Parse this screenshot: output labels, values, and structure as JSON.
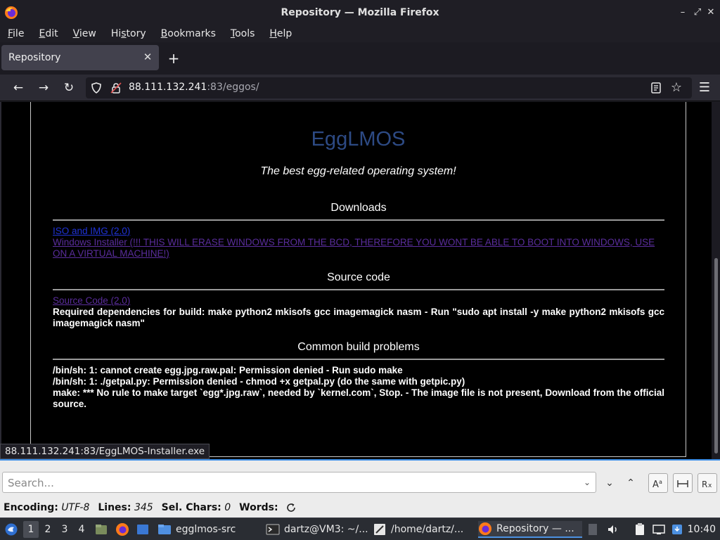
{
  "window": {
    "title": "Repository — Mozilla Firefox"
  },
  "menubar": {
    "items": [
      {
        "pre": "",
        "u": "F",
        "post": "ile"
      },
      {
        "pre": "",
        "u": "E",
        "post": "dit"
      },
      {
        "pre": "",
        "u": "V",
        "post": "iew"
      },
      {
        "pre": "Hi",
        "u": "s",
        "post": "tory"
      },
      {
        "pre": "",
        "u": "B",
        "post": "ookmarks"
      },
      {
        "pre": "",
        "u": "T",
        "post": "ools"
      },
      {
        "pre": "",
        "u": "H",
        "post": "elp"
      }
    ]
  },
  "tabs": {
    "active_label": "Repository",
    "new_tab_symbol": "+"
  },
  "navbar": {
    "url_host": "88.111.132.241",
    "url_rest": ":83/eggos/"
  },
  "page": {
    "logo": "EggLMOS",
    "tagline": "The best egg-related operating system!",
    "downloads_heading": "Downloads",
    "iso_link": "ISO and IMG (2.0)",
    "windows_installer_link": "Windows Installer (!!! THIS WILL ERASE WINDOWS FROM THE BCD, THEREFORE YOU WONT BE ABLE TO BOOT INTO WINDOWS, USE ON A VIRTUAL MACHINE!)",
    "source_heading": "Source code",
    "source_link": "Source Code (2.0)",
    "deps_text": "Required dependencies for build: make python2 mkisofs gcc imagemagick nasm - Run \"sudo apt install -y make python2 mkisofs gcc imagemagick nasm\"",
    "problems_heading": "Common build problems",
    "problems": [
      "/bin/sh: 1: cannot create egg.jpg.raw.pal: Permission denied - Run sudo make",
      "/bin/sh: 1: ./getpal.py: Permission denied - chmod +x getpal.py (do the same with getpic.py)",
      "make: *** No rule to make target `egg*.jpg.raw`, needed by `kernel.com`, Stop. - The image file is not present, Download from the official source."
    ],
    "link_color_unvisited": "#1f33d6",
    "link_color_visited": "#5a2d9c",
    "logo_color": "#2d4a84"
  },
  "status_link": "88.111.132.241:83/EggLMOS-Installer.exe",
  "findbar": {
    "placeholder": "Search..."
  },
  "editor_status": {
    "encoding_label": "Encoding:",
    "encoding_value": "UTF-8",
    "lines_label": "Lines:",
    "lines_value": "345",
    "selchars_label": "Sel. Chars:",
    "selchars_value": "0",
    "words_label": "Words:"
  },
  "taskbar": {
    "workspaces": [
      "1",
      "2",
      "3",
      "4"
    ],
    "apps": [
      {
        "label": "egglmos-src",
        "icon": "folder-icon"
      },
      {
        "label": "dartz@VM3: ~/...",
        "icon": "terminal-icon"
      },
      {
        "label": "/home/dartz/...",
        "icon": "text-editor-icon"
      },
      {
        "label": "Repository — ...",
        "icon": "firefox-icon"
      }
    ],
    "clock": "10:40"
  },
  "colors": {
    "accent": "#3d8ee6",
    "page_bg": "#000000"
  }
}
